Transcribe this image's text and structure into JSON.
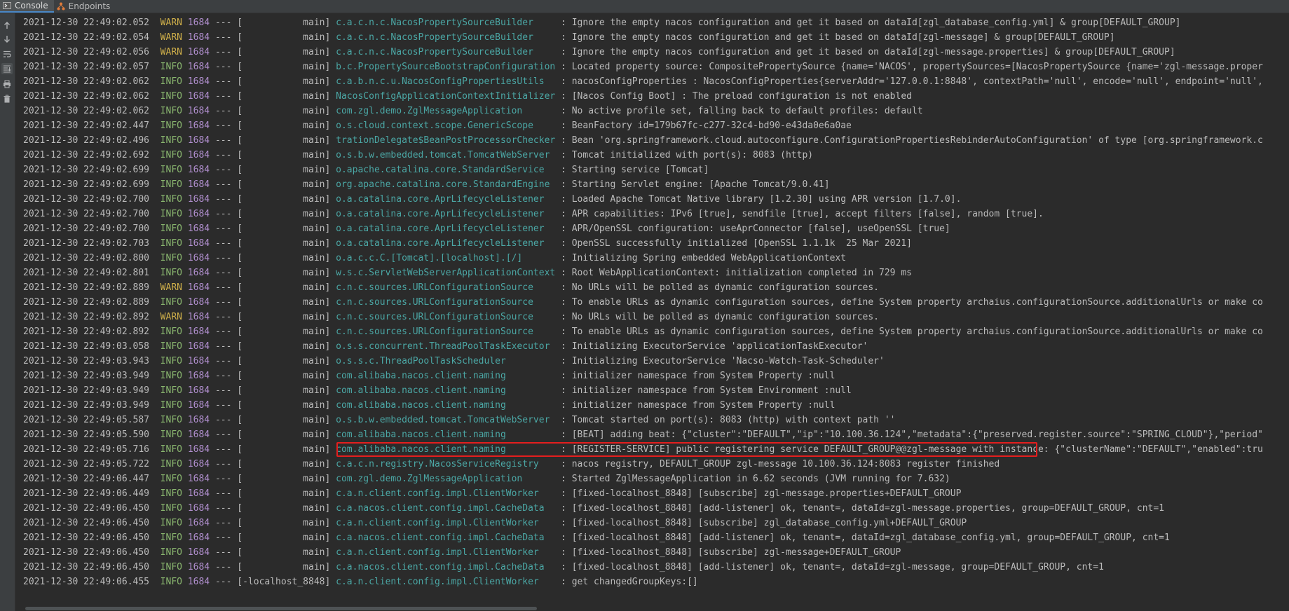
{
  "tabs": [
    {
      "label": "Console",
      "icon": "console-icon",
      "active": true
    },
    {
      "label": "Endpoints",
      "icon": "endpoints-icon",
      "active": false
    }
  ],
  "toolbar": [
    {
      "name": "scroll-up-icon",
      "on": false
    },
    {
      "name": "scroll-down-icon",
      "on": false
    },
    {
      "name": "soft-wrap-icon",
      "on": false
    },
    {
      "name": "scroll-to-end-icon",
      "on": true
    },
    {
      "name": "print-icon",
      "on": false
    },
    {
      "name": "clear-all-icon",
      "on": false
    }
  ],
  "colors": {
    "background": "#2b2b2b",
    "info": "#8ab76f",
    "warn": "#d0b04a",
    "pid": "#b290d0",
    "logger": "#4ba7a5",
    "highlight_border": "#e41e1e"
  },
  "highlighted_row": 30,
  "log": [
    {
      "ts": "2021-12-30 22:49:02.052",
      "level": "WARN",
      "pid": "1684",
      "thread": "           main",
      "logger": "c.a.c.n.c.NacosPropertySourceBuilder    ",
      "msg": "Ignore the empty nacos configuration and get it based on dataId[zgl_database_config.yml] & group[DEFAULT_GROUP]"
    },
    {
      "ts": "2021-12-30 22:49:02.054",
      "level": "WARN",
      "pid": "1684",
      "thread": "           main",
      "logger": "c.a.c.n.c.NacosPropertySourceBuilder    ",
      "msg": "Ignore the empty nacos configuration and get it based on dataId[zgl-message] & group[DEFAULT_GROUP]"
    },
    {
      "ts": "2021-12-30 22:49:02.056",
      "level": "WARN",
      "pid": "1684",
      "thread": "           main",
      "logger": "c.a.c.n.c.NacosPropertySourceBuilder    ",
      "msg": "Ignore the empty nacos configuration and get it based on dataId[zgl-message.properties] & group[DEFAULT_GROUP]"
    },
    {
      "ts": "2021-12-30 22:49:02.057",
      "level": "INFO",
      "pid": "1684",
      "thread": "           main",
      "logger": "b.c.PropertySourceBootstrapConfiguration",
      "msg": "Located property source: CompositePropertySource {name='NACOS', propertySources=[NacosPropertySource {name='zgl-message.proper"
    },
    {
      "ts": "2021-12-30 22:49:02.062",
      "level": "INFO",
      "pid": "1684",
      "thread": "           main",
      "logger": "c.a.b.n.c.u.NacosConfigPropertiesUtils  ",
      "msg": "nacosConfigProperties : NacosConfigProperties{serverAddr='127.0.0.1:8848', contextPath='null', encode='null', endpoint='null',"
    },
    {
      "ts": "2021-12-30 22:49:02.062",
      "level": "INFO",
      "pid": "1684",
      "thread": "           main",
      "logger": "NacosConfigApplicationContextInitializer",
      "msg": "[Nacos Config Boot] : The preload configuration is not enabled"
    },
    {
      "ts": "2021-12-30 22:49:02.062",
      "level": "INFO",
      "pid": "1684",
      "thread": "           main",
      "logger": "com.zgl.demo.ZglMessageApplication      ",
      "msg": "No active profile set, falling back to default profiles: default"
    },
    {
      "ts": "2021-12-30 22:49:02.447",
      "level": "INFO",
      "pid": "1684",
      "thread": "           main",
      "logger": "o.s.cloud.context.scope.GenericScope    ",
      "msg": "BeanFactory id=179b67fc-c277-32c4-bd90-e43da0e6a0ae"
    },
    {
      "ts": "2021-12-30 22:49:02.496",
      "level": "INFO",
      "pid": "1684",
      "thread": "           main",
      "logger": "trationDelegate$BeanPostProcessorChecker",
      "msg": "Bean 'org.springframework.cloud.autoconfigure.ConfigurationPropertiesRebinderAutoConfiguration' of type [org.springframework.c"
    },
    {
      "ts": "2021-12-30 22:49:02.692",
      "level": "INFO",
      "pid": "1684",
      "thread": "           main",
      "logger": "o.s.b.w.embedded.tomcat.TomcatWebServer ",
      "msg": "Tomcat initialized with port(s): 8083 (http)"
    },
    {
      "ts": "2021-12-30 22:49:02.699",
      "level": "INFO",
      "pid": "1684",
      "thread": "           main",
      "logger": "o.apache.catalina.core.StandardService  ",
      "msg": "Starting service [Tomcat]"
    },
    {
      "ts": "2021-12-30 22:49:02.699",
      "level": "INFO",
      "pid": "1684",
      "thread": "           main",
      "logger": "org.apache.catalina.core.StandardEngine ",
      "msg": "Starting Servlet engine: [Apache Tomcat/9.0.41]"
    },
    {
      "ts": "2021-12-30 22:49:02.700",
      "level": "INFO",
      "pid": "1684",
      "thread": "           main",
      "logger": "o.a.catalina.core.AprLifecycleListener  ",
      "msg": "Loaded Apache Tomcat Native library [1.2.30] using APR version [1.7.0]."
    },
    {
      "ts": "2021-12-30 22:49:02.700",
      "level": "INFO",
      "pid": "1684",
      "thread": "           main",
      "logger": "o.a.catalina.core.AprLifecycleListener  ",
      "msg": "APR capabilities: IPv6 [true], sendfile [true], accept filters [false], random [true]."
    },
    {
      "ts": "2021-12-30 22:49:02.700",
      "level": "INFO",
      "pid": "1684",
      "thread": "           main",
      "logger": "o.a.catalina.core.AprLifecycleListener  ",
      "msg": "APR/OpenSSL configuration: useAprConnector [false], useOpenSSL [true]"
    },
    {
      "ts": "2021-12-30 22:49:02.703",
      "level": "INFO",
      "pid": "1684",
      "thread": "           main",
      "logger": "o.a.catalina.core.AprLifecycleListener  ",
      "msg": "OpenSSL successfully initialized [OpenSSL 1.1.1k  25 Mar 2021]"
    },
    {
      "ts": "2021-12-30 22:49:02.800",
      "level": "INFO",
      "pid": "1684",
      "thread": "           main",
      "logger": "o.a.c.c.C.[Tomcat].[localhost].[/]      ",
      "msg": "Initializing Spring embedded WebApplicationContext"
    },
    {
      "ts": "2021-12-30 22:49:02.801",
      "level": "INFO",
      "pid": "1684",
      "thread": "           main",
      "logger": "w.s.c.ServletWebServerApplicationContext",
      "msg": "Root WebApplicationContext: initialization completed in 729 ms"
    },
    {
      "ts": "2021-12-30 22:49:02.889",
      "level": "WARN",
      "pid": "1684",
      "thread": "           main",
      "logger": "c.n.c.sources.URLConfigurationSource    ",
      "msg": "No URLs will be polled as dynamic configuration sources."
    },
    {
      "ts": "2021-12-30 22:49:02.889",
      "level": "INFO",
      "pid": "1684",
      "thread": "           main",
      "logger": "c.n.c.sources.URLConfigurationSource    ",
      "msg": "To enable URLs as dynamic configuration sources, define System property archaius.configurationSource.additionalUrls or make co"
    },
    {
      "ts": "2021-12-30 22:49:02.892",
      "level": "WARN",
      "pid": "1684",
      "thread": "           main",
      "logger": "c.n.c.sources.URLConfigurationSource    ",
      "msg": "No URLs will be polled as dynamic configuration sources."
    },
    {
      "ts": "2021-12-30 22:49:02.892",
      "level": "INFO",
      "pid": "1684",
      "thread": "           main",
      "logger": "c.n.c.sources.URLConfigurationSource    ",
      "msg": "To enable URLs as dynamic configuration sources, define System property archaius.configurationSource.additionalUrls or make co"
    },
    {
      "ts": "2021-12-30 22:49:03.058",
      "level": "INFO",
      "pid": "1684",
      "thread": "           main",
      "logger": "o.s.s.concurrent.ThreadPoolTaskExecutor ",
      "msg": "Initializing ExecutorService 'applicationTaskExecutor'"
    },
    {
      "ts": "2021-12-30 22:49:03.943",
      "level": "INFO",
      "pid": "1684",
      "thread": "           main",
      "logger": "o.s.s.c.ThreadPoolTaskScheduler         ",
      "msg": "Initializing ExecutorService 'Nacso-Watch-Task-Scheduler'"
    },
    {
      "ts": "2021-12-30 22:49:03.949",
      "level": "INFO",
      "pid": "1684",
      "thread": "           main",
      "logger": "com.alibaba.nacos.client.naming         ",
      "msg": "initializer namespace from System Property :null"
    },
    {
      "ts": "2021-12-30 22:49:03.949",
      "level": "INFO",
      "pid": "1684",
      "thread": "           main",
      "logger": "com.alibaba.nacos.client.naming         ",
      "msg": "initializer namespace from System Environment :null"
    },
    {
      "ts": "2021-12-30 22:49:03.949",
      "level": "INFO",
      "pid": "1684",
      "thread": "           main",
      "logger": "com.alibaba.nacos.client.naming         ",
      "msg": "initializer namespace from System Property :null"
    },
    {
      "ts": "2021-12-30 22:49:05.587",
      "level": "INFO",
      "pid": "1684",
      "thread": "           main",
      "logger": "o.s.b.w.embedded.tomcat.TomcatWebServer ",
      "msg": "Tomcat started on port(s): 8083 (http) with context path ''"
    },
    {
      "ts": "2021-12-30 22:49:05.590",
      "level": "INFO",
      "pid": "1684",
      "thread": "           main",
      "logger": "com.alibaba.nacos.client.naming         ",
      "msg": "[BEAT] adding beat: {\"cluster\":\"DEFAULT\",\"ip\":\"10.100.36.124\",\"metadata\":{\"preserved.register.source\":\"SPRING_CLOUD\"},\"period\""
    },
    {
      "ts": "2021-12-30 22:49:05.716",
      "level": "INFO",
      "pid": "1684",
      "thread": "           main",
      "logger": "com.alibaba.nacos.client.naming         ",
      "msg": "[REGISTER-SERVICE] public registering service DEFAULT_GROUP@@zgl-message with instance: {\"clusterName\":\"DEFAULT\",\"enabled\":tru"
    },
    {
      "ts": "2021-12-30 22:49:05.722",
      "level": "INFO",
      "pid": "1684",
      "thread": "           main",
      "logger": "c.a.c.n.registry.NacosServiceRegistry   ",
      "msg": "nacos registry, DEFAULT_GROUP zgl-message 10.100.36.124:8083 register finished"
    },
    {
      "ts": "2021-12-30 22:49:06.447",
      "level": "INFO",
      "pid": "1684",
      "thread": "           main",
      "logger": "com.zgl.demo.ZglMessageApplication      ",
      "msg": "Started ZglMessageApplication in 6.62 seconds (JVM running for 7.632)"
    },
    {
      "ts": "2021-12-30 22:49:06.449",
      "level": "INFO",
      "pid": "1684",
      "thread": "           main",
      "logger": "c.a.n.client.config.impl.ClientWorker   ",
      "msg": "[fixed-localhost_8848] [subscribe] zgl-message.properties+DEFAULT_GROUP"
    },
    {
      "ts": "2021-12-30 22:49:06.450",
      "level": "INFO",
      "pid": "1684",
      "thread": "           main",
      "logger": "c.a.nacos.client.config.impl.CacheData  ",
      "msg": "[fixed-localhost_8848] [add-listener] ok, tenant=, dataId=zgl-message.properties, group=DEFAULT_GROUP, cnt=1"
    },
    {
      "ts": "2021-12-30 22:49:06.450",
      "level": "INFO",
      "pid": "1684",
      "thread": "           main",
      "logger": "c.a.n.client.config.impl.ClientWorker   ",
      "msg": "[fixed-localhost_8848] [subscribe] zgl_database_config.yml+DEFAULT_GROUP"
    },
    {
      "ts": "2021-12-30 22:49:06.450",
      "level": "INFO",
      "pid": "1684",
      "thread": "           main",
      "logger": "c.a.nacos.client.config.impl.CacheData  ",
      "msg": "[fixed-localhost_8848] [add-listener] ok, tenant=, dataId=zgl_database_config.yml, group=DEFAULT_GROUP, cnt=1"
    },
    {
      "ts": "2021-12-30 22:49:06.450",
      "level": "INFO",
      "pid": "1684",
      "thread": "           main",
      "logger": "c.a.n.client.config.impl.ClientWorker   ",
      "msg": "[fixed-localhost_8848] [subscribe] zgl-message+DEFAULT_GROUP"
    },
    {
      "ts": "2021-12-30 22:49:06.450",
      "level": "INFO",
      "pid": "1684",
      "thread": "           main",
      "logger": "c.a.nacos.client.config.impl.CacheData  ",
      "msg": "[fixed-localhost_8848] [add-listener] ok, tenant=, dataId=zgl-message, group=DEFAULT_GROUP, cnt=1"
    },
    {
      "ts": "2021-12-30 22:49:06.455",
      "level": "INFO",
      "pid": "1684",
      "thread": "-localhost_8848",
      "logger": "c.a.n.client.config.impl.ClientWorker   ",
      "msg": "get changedGroupKeys:[]"
    }
  ]
}
